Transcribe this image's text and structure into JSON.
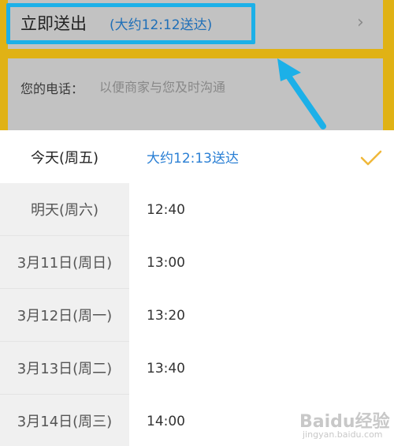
{
  "delivery": {
    "title": "立即送出",
    "eta": "(大约12:12送达)"
  },
  "phone": {
    "label": "您的电话：",
    "placeholder": "以便商家与您及时沟通"
  },
  "days": [
    {
      "label": "今天(周五)",
      "selected": true
    },
    {
      "label": "明天(周六)",
      "selected": false
    },
    {
      "label": "3月11日(周日)",
      "selected": false
    },
    {
      "label": "3月12日(周一)",
      "selected": false
    },
    {
      "label": "3月13日(周二)",
      "selected": false
    },
    {
      "label": "3月14日(周三)",
      "selected": false
    }
  ],
  "times": [
    {
      "label": "大约12:13送达",
      "selected": true
    },
    {
      "label": "12:40",
      "selected": false
    },
    {
      "label": "13:00",
      "selected": false
    },
    {
      "label": "13:20",
      "selected": false
    },
    {
      "label": "13:40",
      "selected": false
    },
    {
      "label": "14:00",
      "selected": false
    }
  ],
  "icons": {
    "chevron": "chevron-right-icon",
    "check": "checkmark-icon"
  },
  "colors": {
    "accent_blue": "#2a7fd4",
    "check_color": "#f0b83a",
    "annotation": "#1cb0e8"
  },
  "watermark": {
    "brand": "Baidu经验",
    "domain": "jingyan.baidu.com"
  }
}
